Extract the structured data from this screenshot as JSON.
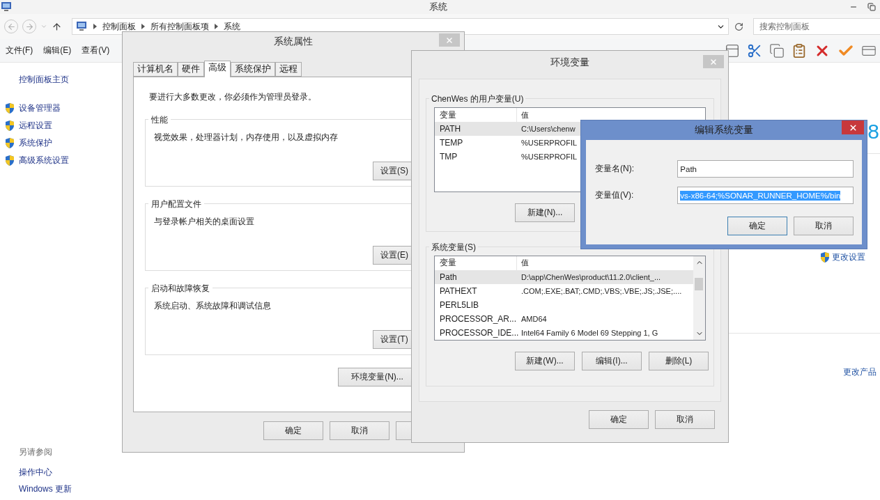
{
  "explorer": {
    "title": "系统",
    "breadcrumb": [
      "控制面板",
      "所有控制面板项",
      "系统"
    ],
    "search": {
      "placeholder": "搜索控制面板"
    },
    "menu": [
      "文件(F)",
      "编辑(E)",
      "查看(V)"
    ],
    "sidebar": {
      "home": "控制面板主页",
      "items": [
        "设备管理器",
        "远程设置",
        "系统保护",
        "高级系统设置"
      ],
      "see_also": {
        "title": "另请参阅",
        "items": [
          "操作中心",
          "Windows 更新"
        ]
      }
    },
    "logo_text": "8",
    "links": [
      "更改设置",
      "更改产品"
    ]
  },
  "system_properties": {
    "title": "系统属性",
    "tabs": [
      {
        "label": "计算机名",
        "selected": false
      },
      {
        "label": "硬件",
        "selected": false
      },
      {
        "label": "高级",
        "selected": true
      },
      {
        "label": "系统保护",
        "selected": false
      },
      {
        "label": "远程",
        "selected": false
      }
    ],
    "notice": "要进行大多数更改，你必须作为管理员登录。",
    "groups": [
      {
        "title": "性能",
        "description": "视觉效果，处理器计划，内存使用，以及虚拟内存",
        "button": "设置(S)"
      },
      {
        "title": "用户配置文件",
        "description": "与登录帐户相关的桌面设置",
        "button": "设置(E)"
      },
      {
        "title": "启动和故障恢复",
        "description": "系统启动、系统故障和调试信息",
        "button": "设置(T)"
      }
    ],
    "env_button": "环境变量(N)...",
    "buttons": [
      "确定",
      "取消"
    ]
  },
  "environment_variables": {
    "title": "环境变量",
    "user_vars": {
      "title": "ChenWes 的用户变量(U)",
      "columns": [
        "变量",
        "值"
      ],
      "rows": [
        {
          "name": "PATH",
          "value": "C:\\Users\\chenw",
          "selected": true
        },
        {
          "name": "TEMP",
          "value": "%USERPROFIL",
          "selected": false
        },
        {
          "name": "TMP",
          "value": "%USERPROFIL",
          "selected": false
        }
      ],
      "buttons": [
        "新建(N)..."
      ]
    },
    "system_vars": {
      "title": "系统变量(S)",
      "columns": [
        "变量",
        "值"
      ],
      "rows": [
        {
          "name": "Path",
          "value": "D:\\app\\ChenWes\\product\\11.2.0\\client_...",
          "selected": true
        },
        {
          "name": "PATHEXT",
          "value": ".COM;.EXE;.BAT;.CMD;.VBS;.VBE;.JS;.JSE;....",
          "selected": false
        },
        {
          "name": "PERL5LIB",
          "value": "",
          "selected": false
        },
        {
          "name": "PROCESSOR_AR...",
          "value": "AMD64",
          "selected": false
        },
        {
          "name": "PROCESSOR_IDE...",
          "value": "Intel64 Family 6 Model 69 Stepping 1, G",
          "selected": false
        }
      ],
      "buttons": [
        "新建(W)...",
        "编辑(I)...",
        "删除(L)"
      ]
    },
    "buttons": [
      "确定",
      "取消"
    ]
  },
  "edit_dialog": {
    "title": "编辑系统变量",
    "fields": [
      {
        "label": "变量名(N):",
        "value": "Path",
        "selected": false
      },
      {
        "label": "变量值(V):",
        "value": "vs-x86-64;%SONAR_RUNNER_HOME%/bin",
        "selected": true
      }
    ],
    "buttons": [
      {
        "label": "确定",
        "default": true
      },
      {
        "label": "取消",
        "default": false
      }
    ]
  }
}
